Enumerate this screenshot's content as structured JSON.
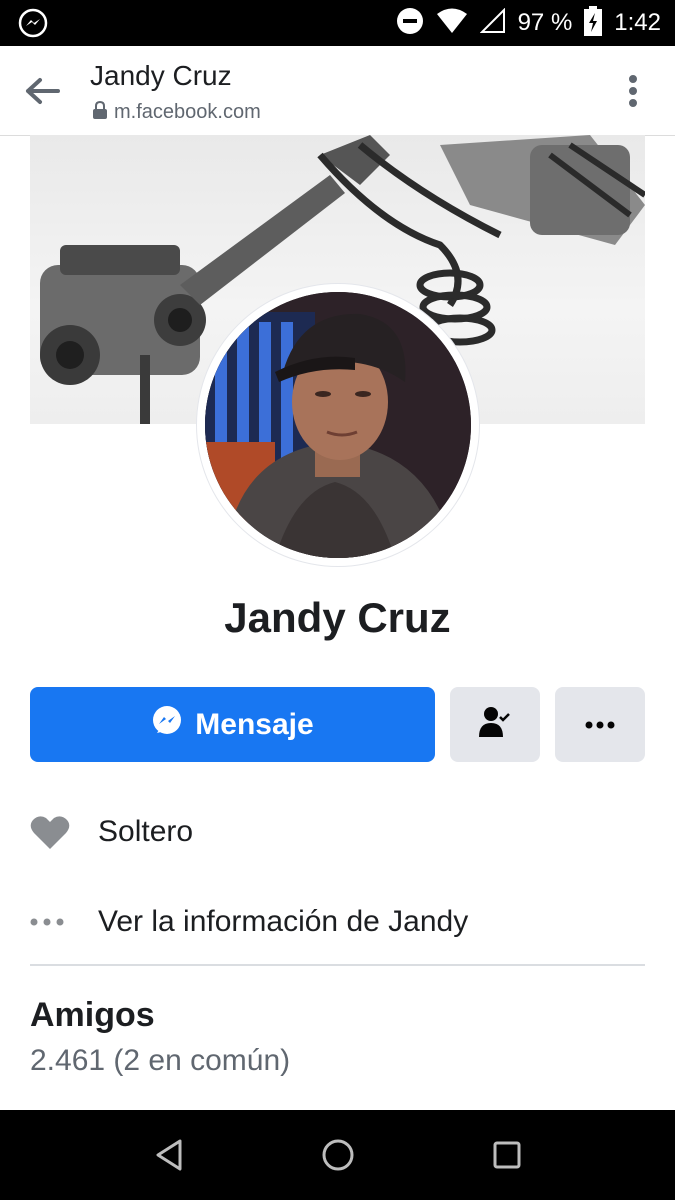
{
  "status_bar": {
    "battery": "97 %",
    "time": "1:42",
    "icons": [
      "messenger-icon",
      "do-not-disturb-icon",
      "wifi-icon",
      "signal-icon",
      "battery-charging-icon"
    ]
  },
  "browser": {
    "title": "Jandy Cruz",
    "url": "m.facebook.com",
    "icons": [
      "back-arrow-icon",
      "lock-icon",
      "more-vert-icon"
    ]
  },
  "profile": {
    "name": "Jandy Cruz"
  },
  "actions": {
    "message_label": "Mensaje",
    "icons": [
      "messenger-icon",
      "friends-check-icon",
      "more-horiz-icon"
    ]
  },
  "info": {
    "relationship": "Soltero",
    "see_info": "Ver la información de Jandy"
  },
  "friends": {
    "title": "Amigos",
    "count": "2.461 (2 en común)"
  },
  "colors": {
    "primary": "#1877f2",
    "secondary_button": "#e4e6eb",
    "text": "#1c1e21",
    "muted": "#606770"
  }
}
